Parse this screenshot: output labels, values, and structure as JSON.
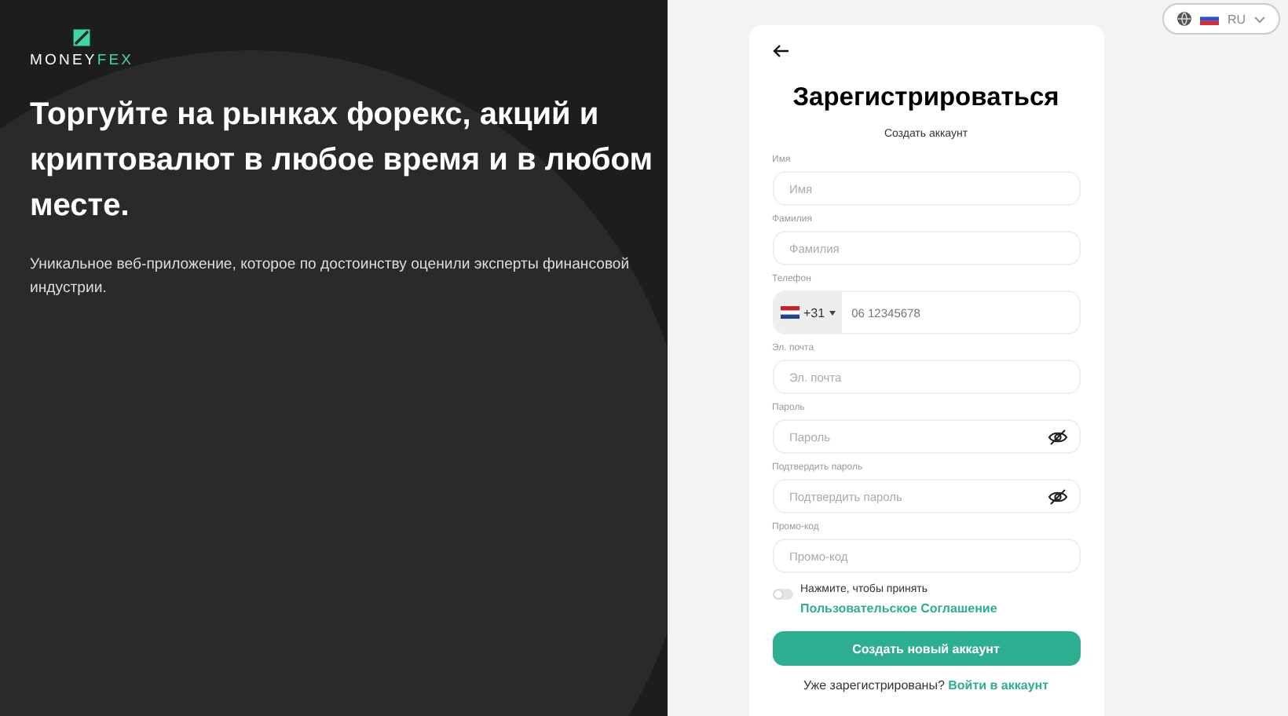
{
  "brand": {
    "name_part_1": "MONEY",
    "name_part_2": "FEX"
  },
  "hero": {
    "headline": "Торгуйте на рынках форекс, акций и криптовалют в любое время и в любом месте.",
    "description": "Уникальное веб-приложение, которое по достоинству оценили эксперты финансовой индустрии."
  },
  "language": {
    "code": "RU"
  },
  "form": {
    "title": "Зарегистрироваться",
    "subtitle": "Создать аккаунт",
    "fields": [
      {
        "kind": "text",
        "label": "Имя",
        "placeholder": "Имя"
      },
      {
        "kind": "text",
        "label": "Фамилия",
        "placeholder": "Фамилия"
      },
      {
        "kind": "phone",
        "label": "Телефон",
        "country_code": "+31",
        "placeholder": "06 12345678"
      },
      {
        "kind": "text",
        "label": "Эл. почта",
        "placeholder": "Эл. почта"
      },
      {
        "kind": "password",
        "label": "Пароль",
        "placeholder": "Пароль"
      },
      {
        "kind": "password",
        "label": "Подтвердить пароль",
        "placeholder": "Подтвердить пароль"
      },
      {
        "kind": "text",
        "label": "Промо-код",
        "placeholder": "Промо-код"
      }
    ],
    "agreement": {
      "on": false,
      "text": "Нажмите, чтобы принять",
      "link": "Пользовательское Соглашение"
    },
    "submit": "Создать новый аккаунт",
    "footer_text": "Уже зарегистрированы?",
    "footer_link": "Войти в аккаунт"
  }
}
